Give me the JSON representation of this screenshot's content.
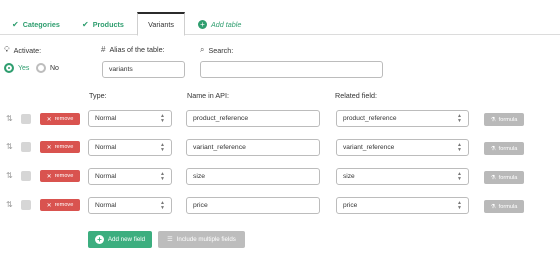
{
  "tabs": [
    {
      "label": "Categories",
      "icon": "check-icon",
      "completed": true
    },
    {
      "label": "Products",
      "icon": "check-icon",
      "completed": true
    },
    {
      "label": "Variants",
      "active": true
    },
    {
      "label": "Add table",
      "icon": "plus-circle-icon"
    }
  ],
  "activate": {
    "label": "Activate:",
    "yes": "Yes",
    "no": "No",
    "selected": "Yes"
  },
  "alias": {
    "label": "Alias of the table:",
    "value": "variants"
  },
  "search": {
    "label": "Search:",
    "value": ""
  },
  "columns": {
    "type": "Type:",
    "api_name": "Name in API:",
    "related": "Related field:"
  },
  "rows": [
    {
      "remove": "remove",
      "type": "Normal",
      "api_name": "product_reference",
      "related": "product_reference",
      "formula": "formula"
    },
    {
      "remove": "remove",
      "type": "Normal",
      "api_name": "variant_reference",
      "related": "variant_reference",
      "formula": "formula"
    },
    {
      "remove": "remove",
      "type": "Normal",
      "api_name": "size",
      "related": "size",
      "formula": "formula"
    },
    {
      "remove": "remove",
      "type": "Normal",
      "api_name": "price",
      "related": "price",
      "formula": "formula"
    }
  ],
  "actions": {
    "add_field": "Add new field",
    "include_multiple": "Include multiple fields"
  },
  "colors": {
    "accent": "#2f9e6f",
    "danger": "#d9534f",
    "muted": "#b9b9b9"
  }
}
